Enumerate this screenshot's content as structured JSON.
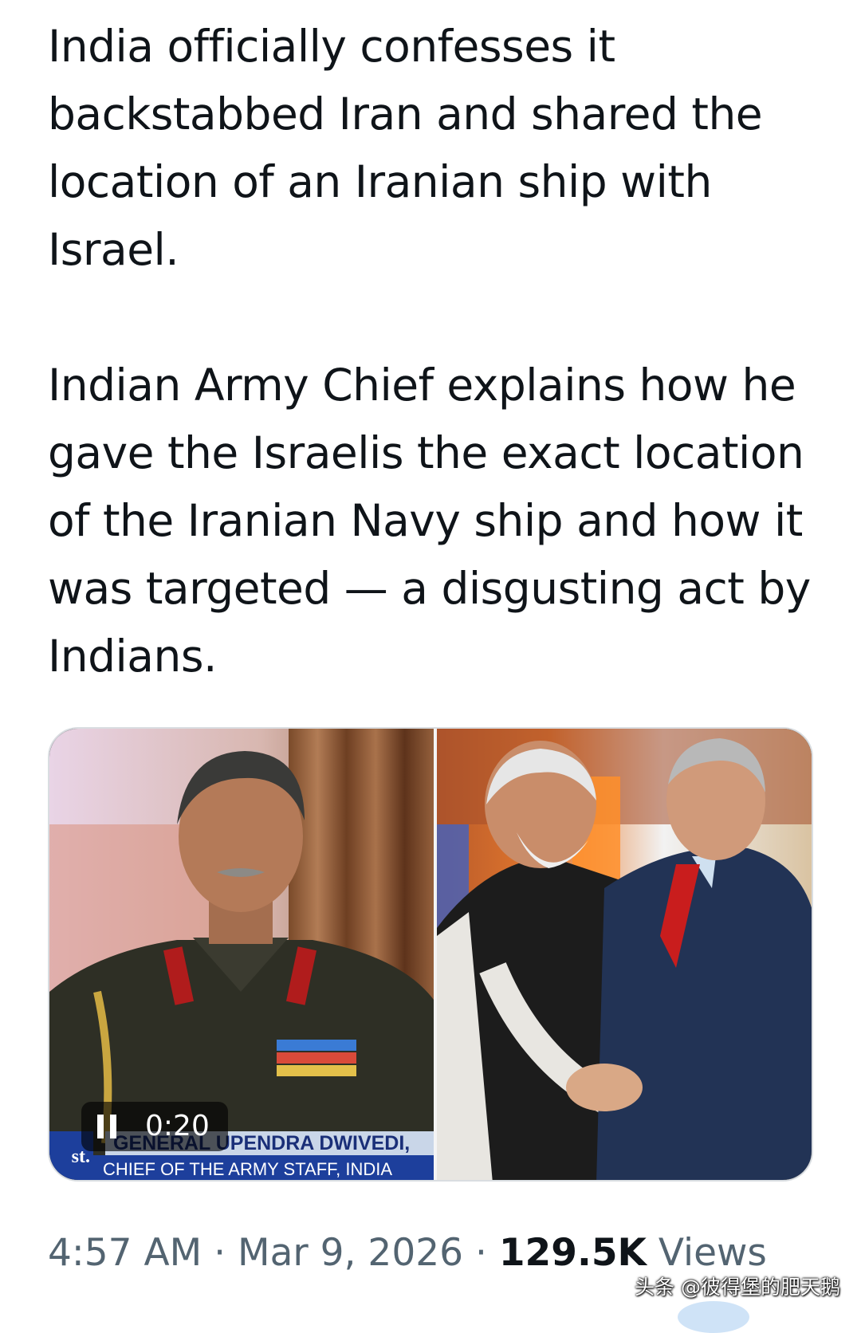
{
  "tweet": {
    "paragraph1": "India officially confesses it\nbackstabbed Iran and shared the\nlocation of an Iranian ship with\nIsrael.",
    "paragraph2": "Indian Army Chief explains how he\ngave the Israelis the exact location\nof the Iranian Navy ship and how it\nwas targeted — a disgusting act by\nIndians."
  },
  "media": {
    "video_time": "0:20",
    "pause_icon": "pause-icon",
    "lower_third": {
      "name": "GENERAL UPENDRA DWIVEDI,",
      "role": "CHIEF OF THE ARMY STAFF, INDIA",
      "channel": "st."
    }
  },
  "meta": {
    "time": "4:57 AM",
    "separator": " · ",
    "date": "Mar 9, 2026",
    "views_count": "129.5K",
    "views_label": " Views"
  },
  "watermark": "头条 @彼得堡的肥天鹅",
  "colors": {
    "text_primary": "#0f1419",
    "text_secondary": "#536471",
    "lower_third_blue": "#1d3f9c"
  }
}
